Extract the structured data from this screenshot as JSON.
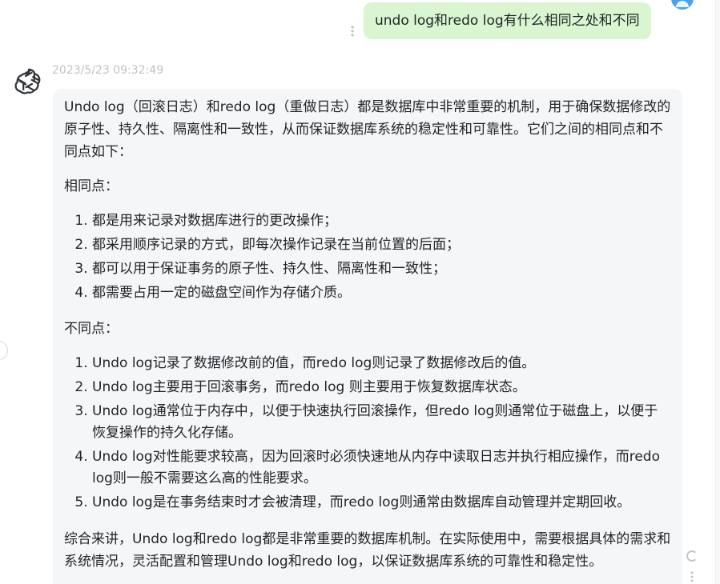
{
  "conversation": {
    "user_message": "undo log和redo log有什么相同之处和不同",
    "assistant": {
      "timestamp": "2023/5/23 09:32:49",
      "intro": "Undo log（回滚日志）和redo log（重做日志）都是数据库中非常重要的机制，用于确保数据修改的原子性、持久性、隔离性和一致性，从而保证数据库系统的稳定性和可靠性。它们之间的相同点和不同点如下：",
      "similarities_title": "相同点：",
      "similarities": [
        "都是用来记录对数据库进行的更改操作；",
        "都采用顺序记录的方式，即每次操作记录在当前位置的后面；",
        "都可以用于保证事务的原子性、持久性、隔离性和一致性；",
        "都需要占用一定的磁盘空间作为存储介质。"
      ],
      "differences_title": "不同点：",
      "differences": [
        "Undo log记录了数据修改前的值，而redo log则记录了数据修改后的值。",
        "Undo log主要用于回滚事务，而redo log 则主要用于恢复数据库状态。",
        "Undo log通常位于内存中，以便于快速执行回滚操作，但redo log则通常位于磁盘上，以便于恢复操作的持久化存储。",
        "Undo log对性能要求较高，因为回滚时必须快速地从内存中读取日志并执行相应操作，而redo log则一般不需要这么高的性能要求。",
        "Undo log是在事务结束时才会被清理，而redo log则通常由数据库自动管理并定期回收。"
      ],
      "conclusion": "综合来讲，Undo log和redo log都是非常重要的数据库机制。在实际使用中，需要根据具体的需求和系统情况，灵活配置和管理Undo log和redo log，以保证数据库系统的可靠性和稳定性。"
    }
  },
  "icons": {
    "assistant_avatar": "openai-logo-icon",
    "user_avatar": "user-avatar-icon",
    "message_menu": "vertical-ellipsis-icon",
    "regenerate": "refresh-icon",
    "more": "vertical-ellipsis-icon"
  },
  "colors": {
    "user_bubble": "#d9f6d1",
    "answer_card": "#f5f6f8",
    "timestamp": "#bfc3c9",
    "text": "#1f2328"
  }
}
